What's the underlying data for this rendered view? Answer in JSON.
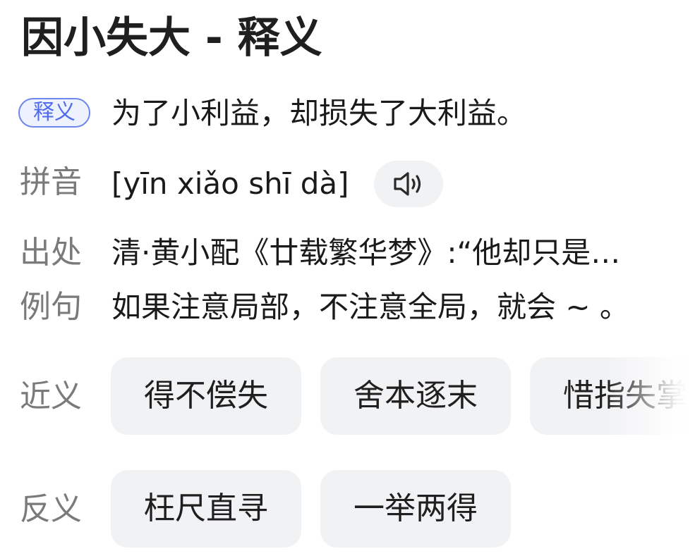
{
  "title": "因小失大 - 释义",
  "definition": {
    "badge": "释义",
    "text": "为了小利益，却损失了大利益。"
  },
  "pinyin": {
    "label": "拼音",
    "text": "[yīn xiǎo shī dà]",
    "audio_icon": "speaker-icon"
  },
  "source": {
    "label": "出处",
    "text": "清·黄小配《廿载繁华梦》:“他却只是…"
  },
  "example": {
    "label": "例句",
    "text": "如果注意局部，不注意全局，就会 ~ 。"
  },
  "synonyms": {
    "label": "近义",
    "items": [
      "得不偿失",
      "舍本逐末",
      "惜指失掌"
    ]
  },
  "antonyms": {
    "label": "反义",
    "items": [
      "枉尺直寻",
      "一举两得"
    ]
  },
  "colors": {
    "badge_border": "#6e86ee",
    "badge_text": "#4f6bea",
    "chip_background": "#f1f2f4",
    "label_text": "#7a7a7a"
  }
}
